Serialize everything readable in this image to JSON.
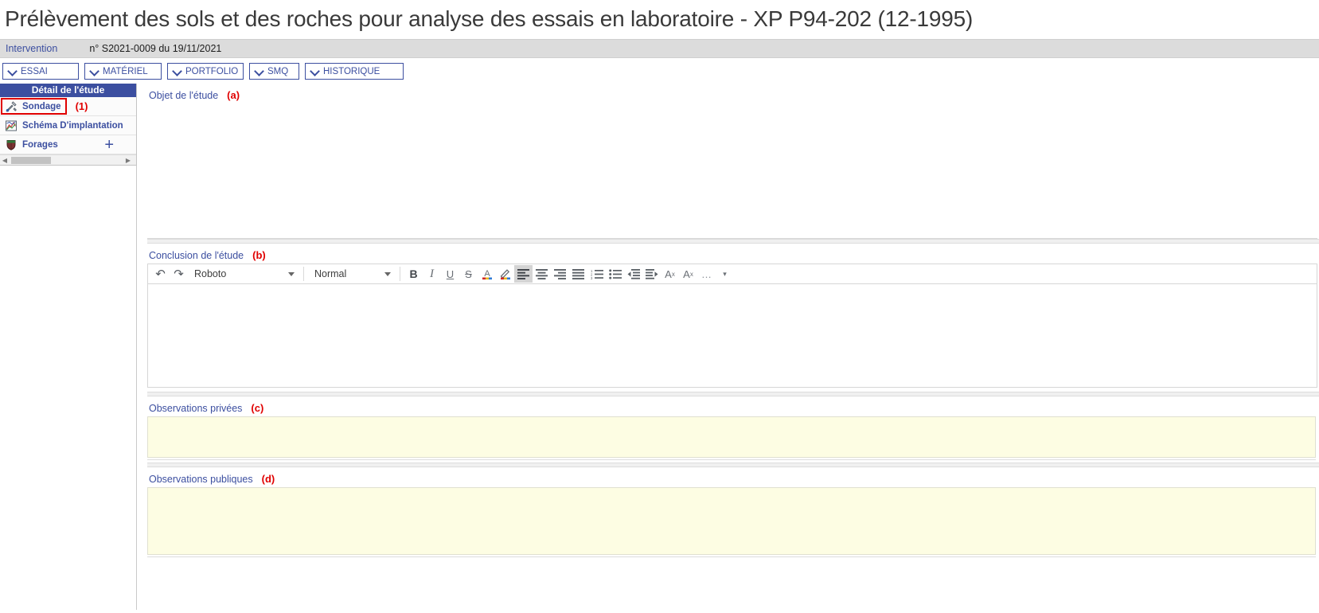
{
  "page_title": "Prélèvement des sols et des roches pour analyse des essais en laboratoire - XP P94-202 (12-1995)",
  "intervention": {
    "label": "Intervention",
    "reference": "n° S2021-0009 du 19/11/2021"
  },
  "tabs": [
    {
      "label": "ESSAI",
      "icon": "chevron-down-icon"
    },
    {
      "label": "MATÉRIEL",
      "icon": "chevron-down-icon"
    },
    {
      "label": "PORTFOLIO",
      "icon": "chevron-down-icon"
    },
    {
      "label": "SMQ",
      "icon": "chevron-down-icon"
    },
    {
      "label": "HISTORIQUE",
      "icon": "chevron-down-icon"
    }
  ],
  "sidebar": {
    "header": "Détail de l'étude",
    "items": [
      {
        "label": "Sondage",
        "icon": "tools-icon",
        "selected": true,
        "annotation": "(1)"
      },
      {
        "label": "Schéma D'implantation",
        "icon": "chart-icon",
        "selected": false,
        "annotation": ""
      },
      {
        "label": "Forages",
        "icon": "shield-icon",
        "selected": false,
        "annotation": "",
        "add_label": "+"
      }
    ]
  },
  "fields": {
    "objet": {
      "label": "Objet de l'étude",
      "annotation": "(a)",
      "value": ""
    },
    "conclusion": {
      "label": "Conclusion de l'étude",
      "annotation": "(b)",
      "value": ""
    },
    "observations_privees": {
      "label": "Observations privées",
      "annotation": "(c)",
      "value": "",
      "placeholder": ""
    },
    "observations_publiques": {
      "label": "Observations publiques",
      "annotation": "(d)",
      "value": "",
      "placeholder": ""
    }
  },
  "editor_toolbar": {
    "undo": {
      "name": "undo-icon",
      "glyph": "↶"
    },
    "redo": {
      "name": "redo-icon",
      "glyph": "↷"
    },
    "font_family": "Roboto",
    "paragraph_style": "Normal",
    "buttons": [
      {
        "name": "bold-button",
        "glyph": "B",
        "active": false
      },
      {
        "name": "italic-button",
        "glyph": "I",
        "active": false
      },
      {
        "name": "underline-button",
        "glyph": "U",
        "active": false
      },
      {
        "name": "strikethrough-button",
        "glyph": "S",
        "active": false
      },
      {
        "name": "text-color-button",
        "glyph": "A",
        "active": false
      },
      {
        "name": "highlight-button",
        "glyph": "✎",
        "active": false
      },
      {
        "name": "align-left-button",
        "glyph": "",
        "active": true
      },
      {
        "name": "align-center-button",
        "glyph": "",
        "active": false
      },
      {
        "name": "align-right-button",
        "glyph": "",
        "active": false
      },
      {
        "name": "align-justify-button",
        "glyph": "",
        "active": false
      },
      {
        "name": "ordered-list-button",
        "glyph": "",
        "active": false
      },
      {
        "name": "bullet-list-button",
        "glyph": "",
        "active": false
      },
      {
        "name": "outdent-button",
        "glyph": "",
        "active": false
      },
      {
        "name": "indent-button",
        "glyph": "",
        "active": false
      },
      {
        "name": "superscript-button",
        "glyph": "A",
        "active": false
      },
      {
        "name": "subscript-button",
        "glyph": "A",
        "active": false
      },
      {
        "name": "more-options-button",
        "glyph": "…",
        "active": false
      },
      {
        "name": "overflow-caret-button",
        "glyph": "▾",
        "active": false
      }
    ]
  },
  "colors": {
    "brand_blue": "#3c4fa0",
    "annotation_red": "#e00000",
    "textarea_yellow": "#fdfde3",
    "intervention_gray": "#dcdcdc"
  }
}
